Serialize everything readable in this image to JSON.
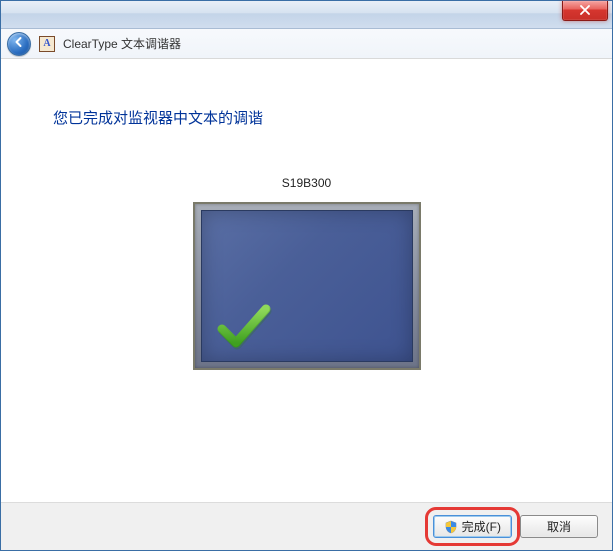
{
  "window": {
    "title": "ClearType 文本调谐器"
  },
  "content": {
    "heading": "您已完成对监视器中文本的调谐",
    "monitor_name": "S19B300"
  },
  "buttons": {
    "finish": "完成(F)",
    "cancel": "取消"
  }
}
